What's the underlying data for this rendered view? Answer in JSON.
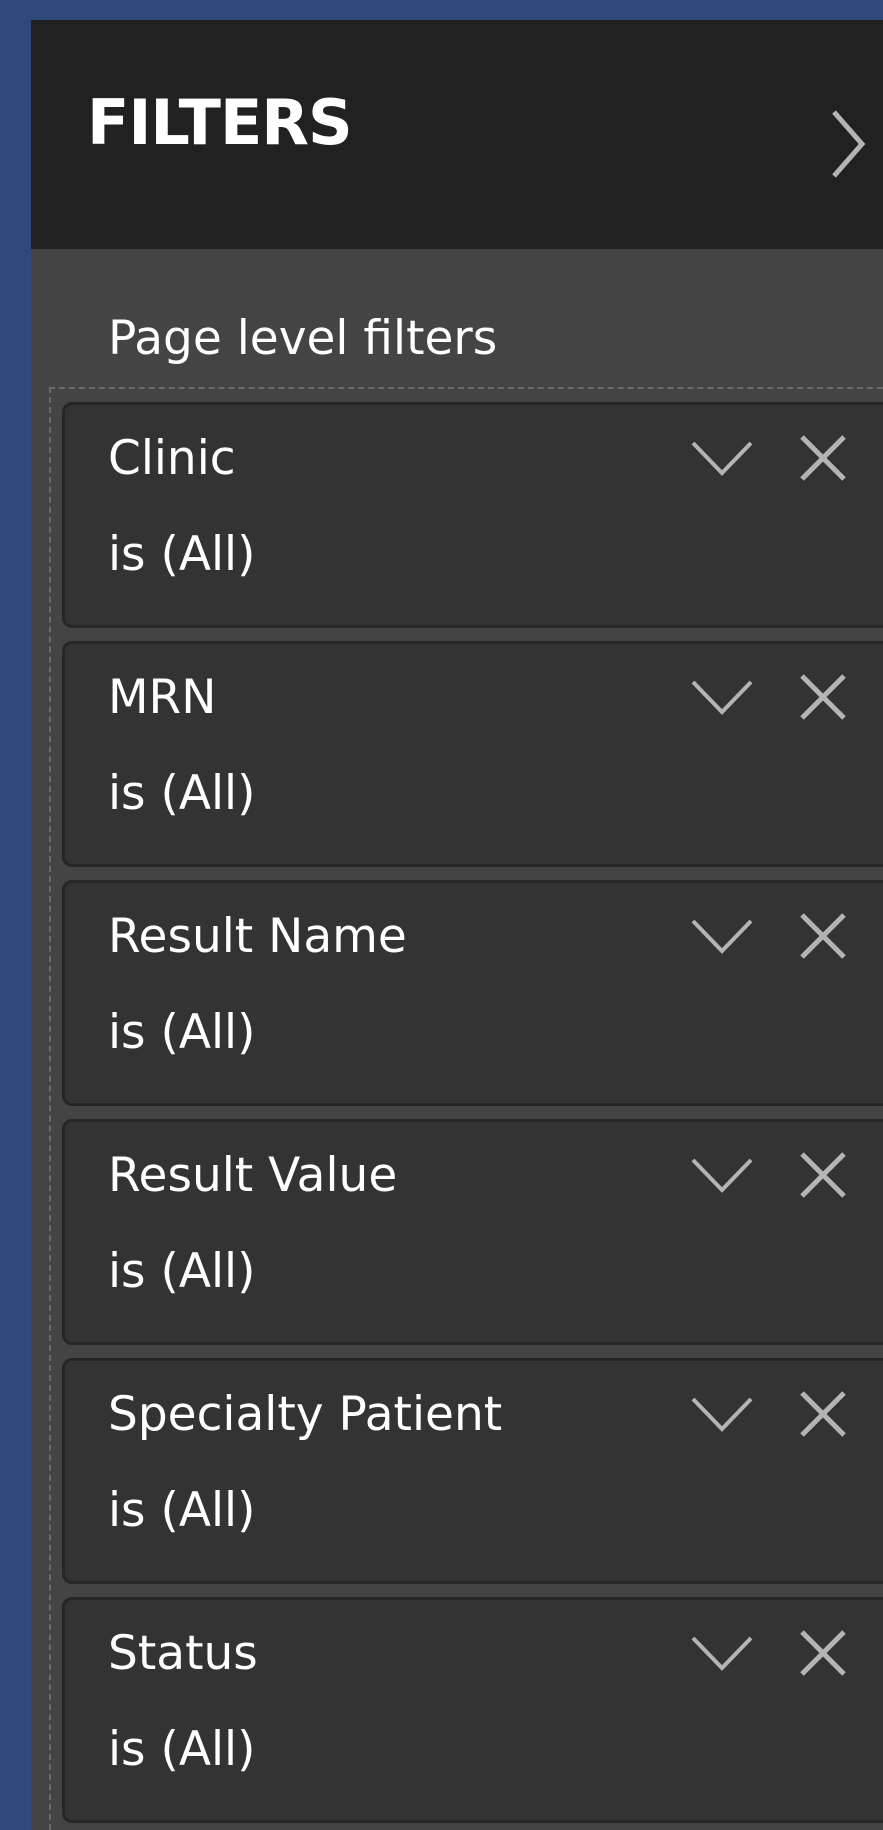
{
  "pane": {
    "title": "FILTERS",
    "collapse_icon": "chevron-right-icon"
  },
  "section": {
    "label": "Page level filters"
  },
  "filters": [
    {
      "name": "Clinic",
      "state": "is (All)"
    },
    {
      "name": "MRN",
      "state": "is (All)"
    },
    {
      "name": "Result Name",
      "state": "is (All)"
    },
    {
      "name": "Result Value",
      "state": "is (All)"
    },
    {
      "name": "Specialty Patient",
      "state": "is (All)"
    },
    {
      "name": "Status",
      "state": "is (All)"
    }
  ],
  "icons": {
    "expand": "chevron-down-icon",
    "remove": "close-icon"
  },
  "colors": {
    "background": "#2e4a7a",
    "header": "#212121",
    "pane": "#444444",
    "card": "#333333",
    "text": "#ffffff",
    "icon": "#b4b4b4"
  }
}
